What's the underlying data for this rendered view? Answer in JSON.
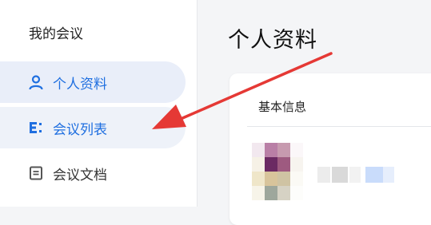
{
  "sidebar": {
    "title": "我的会议",
    "items": [
      {
        "label": "个人资料",
        "icon": "person-icon",
        "state": "active"
      },
      {
        "label": "会议列表",
        "icon": "list-icon",
        "state": "hover"
      },
      {
        "label": "会议文档",
        "icon": "document-icon",
        "state": "normal"
      }
    ]
  },
  "main": {
    "page_title": "个人资料",
    "card": {
      "section_label": "基本信息"
    }
  },
  "colors": {
    "accent": "#1f6fe0",
    "annotation_arrow": "#e53935",
    "active_bg": "#e9eef9"
  }
}
